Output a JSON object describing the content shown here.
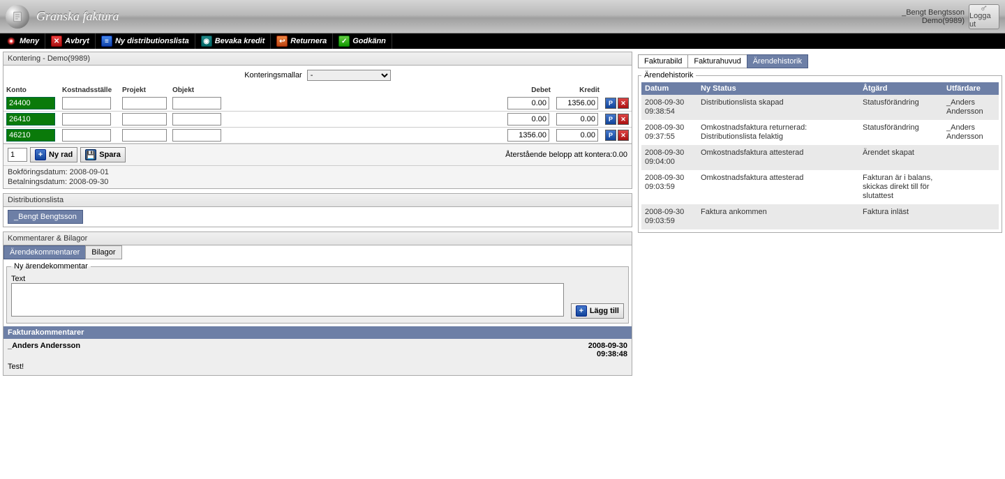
{
  "titlebar": {
    "title": "Granska faktura",
    "username": "_Bengt Bengtsson",
    "company": "Demo(9989)",
    "logout": "Logga ut"
  },
  "toolbar": {
    "meny": "Meny",
    "avbryt": "Avbryt",
    "ny_dist": "Ny distributionslista",
    "bevaka": "Bevaka kredit",
    "returnera": "Returnera",
    "godkann": "Godkänn"
  },
  "kontering": {
    "header": "Kontering - Demo(9989)",
    "mallar_label": "Konteringsmallar",
    "mallar_value": "-",
    "columns": {
      "konto": "Konto",
      "kostnad": "Kostnadsställe",
      "projekt": "Projekt",
      "objekt": "Objekt",
      "debet": "Debet",
      "kredit": "Kredit"
    },
    "rows": [
      {
        "konto": "24400",
        "kostnad": "",
        "projekt": "",
        "objekt": "",
        "debet": "0.00",
        "kredit": "1356.00"
      },
      {
        "konto": "26410",
        "kostnad": "",
        "projekt": "",
        "objekt": "",
        "debet": "0.00",
        "kredit": "0.00"
      },
      {
        "konto": "46210",
        "kostnad": "",
        "projekt": "",
        "objekt": "",
        "debet": "1356.00",
        "kredit": "0.00"
      }
    ],
    "rows_to_add": "1",
    "ny_rad": "Ny rad",
    "spara": "Spara",
    "remaining": "Återstående belopp att kontera:0.00",
    "bokfor": "Bokföringsdatum: 2008-09-01",
    "betal": "Betalningsdatum: 2008-09-30"
  },
  "distlista": {
    "header": "Distributionslista",
    "user": "_Bengt Bengtsson"
  },
  "kommentarer": {
    "header": "Kommentarer & Bilagor",
    "tab_arende": "Ärendekommentarer",
    "tab_bilagor": "Bilagor",
    "fs_legend": "Ny ärendekommentar",
    "text_label": "Text",
    "lagg_till": "Lägg till",
    "fakturakommentarer": "Fakturakommentarer",
    "entries": [
      {
        "author": "_Anders Andersson",
        "date": "2008-09-30",
        "time": "09:38:48",
        "text": "Test!"
      }
    ]
  },
  "right": {
    "tab_bild": "Fakturabild",
    "tab_huvud": "Fakturahuvud",
    "tab_hist": "Ärendehistorik",
    "fs_legend": "Ärendehistorik",
    "columns": {
      "datum": "Datum",
      "status": "Ny Status",
      "atgard": "Åtgärd",
      "utfardare": "Utfärdare"
    },
    "rows": [
      {
        "datum": "2008-09-30 09:38:54",
        "status": "Distributionslista skapad",
        "atgard": "Statusförändring",
        "utfardare": "_Anders Andersson"
      },
      {
        "datum": "2008-09-30 09:37:55",
        "status": "Omkostnadsfaktura returnerad: Distributionslista felaktig",
        "atgard": "Statusförändring",
        "utfardare": "_Anders Andersson"
      },
      {
        "datum": "2008-09-30 09:04:00",
        "status": "Omkostnadsfaktura attesterad",
        "atgard": "Ärendet skapat",
        "utfardare": ""
      },
      {
        "datum": "2008-09-30 09:03:59",
        "status": "Omkostnadsfaktura attesterad",
        "atgard": "Fakturan är i balans, skickas direkt till för slutattest",
        "utfardare": ""
      },
      {
        "datum": "2008-09-30 09:03:59",
        "status": "Faktura ankommen",
        "atgard": "Faktura inläst",
        "utfardare": ""
      }
    ]
  }
}
